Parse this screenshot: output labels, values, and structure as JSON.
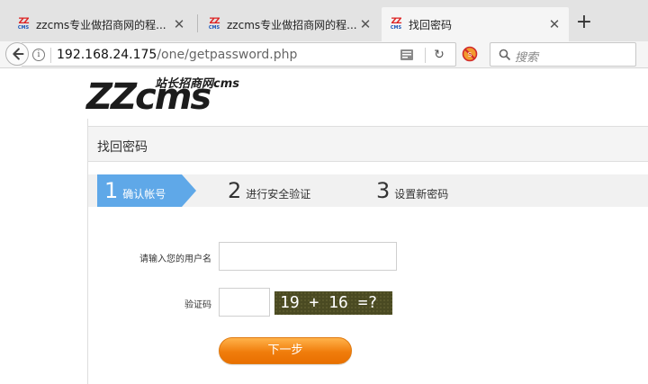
{
  "browser": {
    "tabs": [
      {
        "title": "zzcms专业做招商网的程...",
        "active": false
      },
      {
        "title": "zzcms专业做招商网的程...",
        "active": false
      },
      {
        "title": "找回密码",
        "active": true
      }
    ],
    "favicon": {
      "top": "ZZ",
      "bottom": "CMS"
    },
    "url": {
      "host": "192.168.24.175",
      "path": "/one/getpassword.php"
    },
    "search_placeholder": "搜索",
    "icons": [
      "back-arrow-icon",
      "info-icon",
      "reader-view-icon",
      "reload-icon",
      "noscript-icon",
      "search-icon",
      "close-icon",
      "plus-icon"
    ]
  },
  "page": {
    "logo": {
      "main": "ZZcms",
      "slogan": "站长招商网cms"
    },
    "panel_title": "找回密码",
    "steps": [
      {
        "num": "1",
        "label": "确认帐号",
        "active": true
      },
      {
        "num": "2",
        "label": "进行安全验证",
        "active": false
      },
      {
        "num": "3",
        "label": "设置新密码",
        "active": false
      }
    ],
    "form": {
      "username_label": "请输入您的用户名",
      "username_value": "",
      "captcha_label": "验证码",
      "captcha_value": "",
      "captcha_text": "19 + 16 =?",
      "next_button": "下一步"
    }
  },
  "colors": {
    "step_active": "#5fa8e8",
    "button_orange": "#f07d0c",
    "captcha_bg": "#4a4a22"
  }
}
